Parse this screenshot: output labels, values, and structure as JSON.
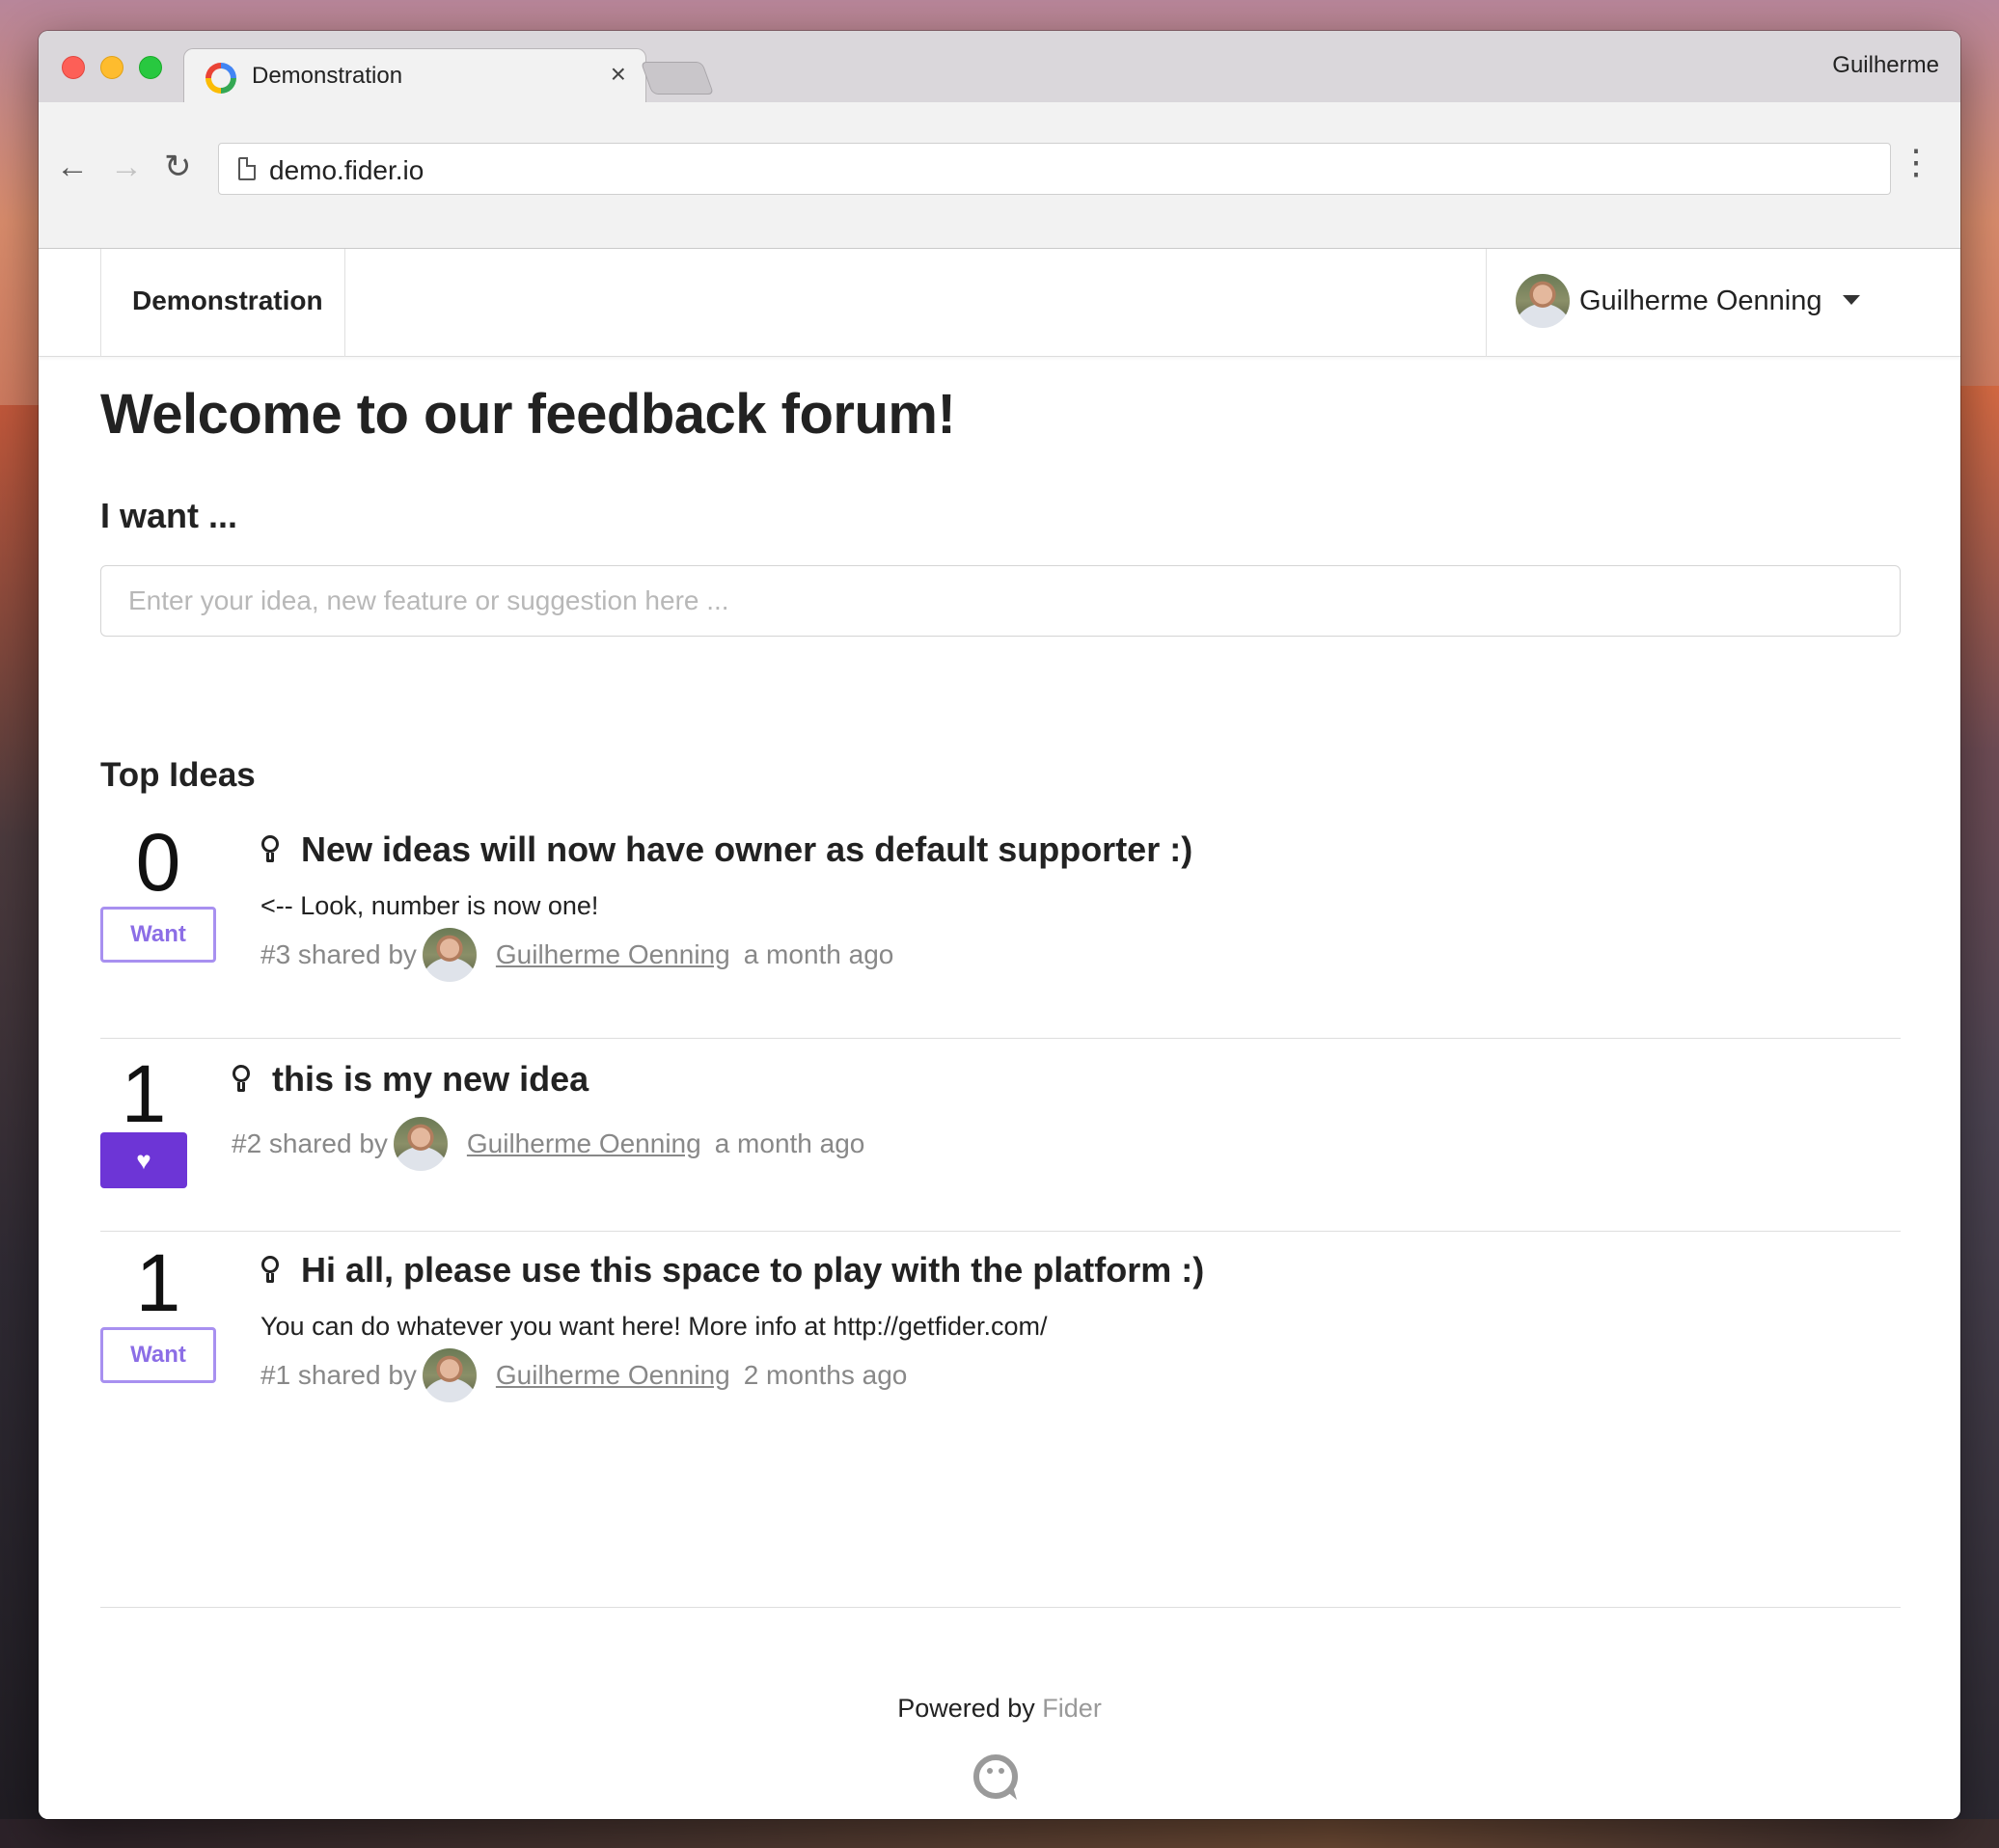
{
  "browser": {
    "tab_title": "Demonstration",
    "tab_close": "×",
    "profile_name": "Guilherme",
    "url": "demo.fider.io",
    "back": "←",
    "forward": "→",
    "reload": "↻",
    "menu": "⋮"
  },
  "header": {
    "brand": "Demonstration",
    "user_name": "Guilherme Oenning"
  },
  "main": {
    "title": "Welcome to our feedback forum!",
    "prompt_label": "I want ...",
    "input_placeholder": "Enter your idea, new feature or suggestion here ...",
    "input_value": "",
    "section_title": "Top Ideas",
    "ideas": [
      {
        "votes": "0",
        "button": "Want",
        "supported": false,
        "title": "New ideas will now have owner as default supporter :)",
        "description": "<-- Look, number is now one!",
        "number": "#3 shared by",
        "author": "Guilherme Oenning",
        "time": "a month ago"
      },
      {
        "votes": "1",
        "button": "♥",
        "supported": true,
        "title": "this is my new idea",
        "description": "",
        "number": "#2 shared by",
        "author": "Guilherme Oenning",
        "time": "a month ago"
      },
      {
        "votes": "1",
        "button": "Want",
        "supported": false,
        "title": "Hi all, please use this space to play with the platform :)",
        "description": "You can do whatever you want here! More info at http://getfider.com/",
        "number": "#1 shared by",
        "author": "Guilherme Oenning",
        "time": "2 months ago"
      }
    ]
  },
  "footer": {
    "powered_by": "Powered by",
    "brand": "Fider"
  },
  "colors": {
    "accent": "#6d35d6",
    "want_border": "#a890f0",
    "muted_text": "#888888"
  }
}
